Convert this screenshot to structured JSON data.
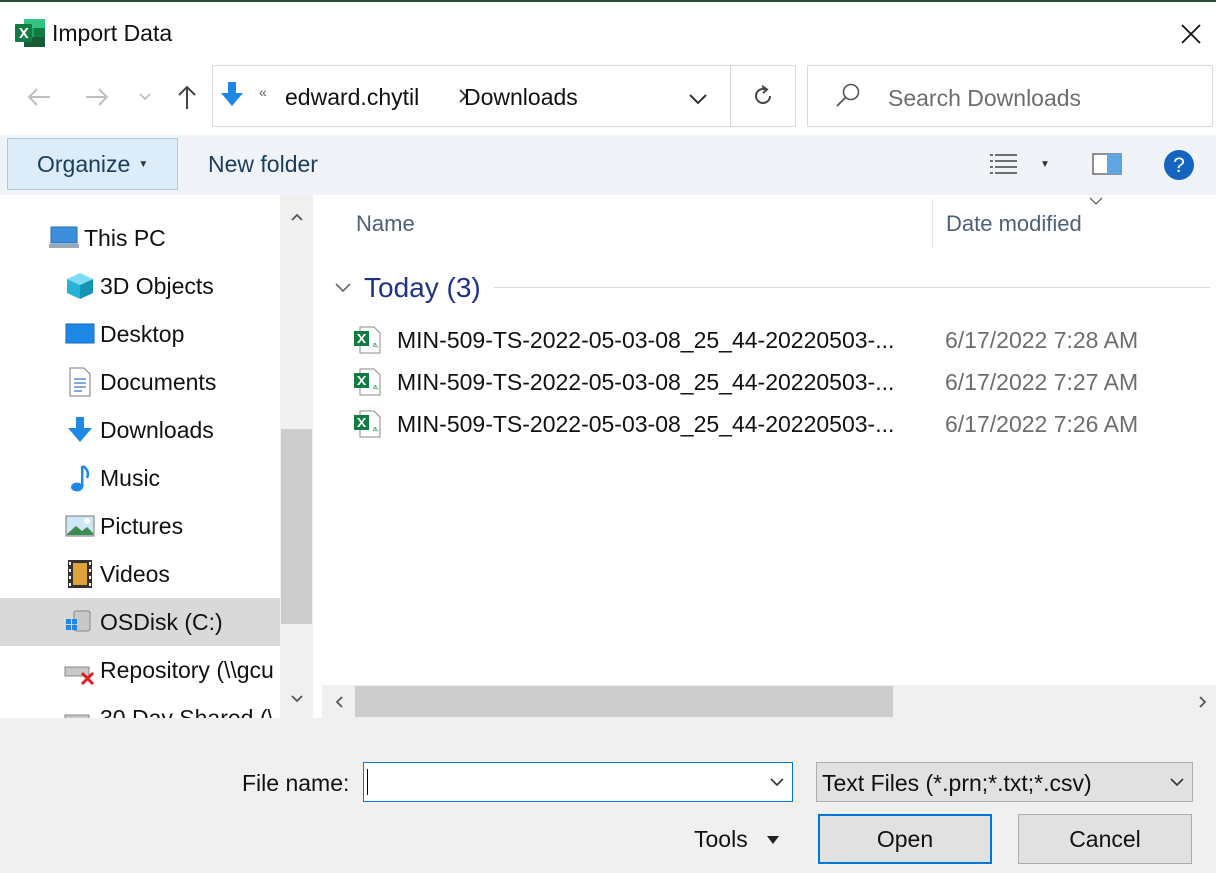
{
  "window": {
    "title": "Import Data",
    "app_icon": "excel-icon",
    "close_icon": "close-icon",
    "frame_color": "#2d4a39"
  },
  "navigation": {
    "back_icon": "back-arrow-icon",
    "forward_icon": "forward-arrow-icon",
    "recent_icon": "chevron-down-icon",
    "up_icon": "up-arrow-icon"
  },
  "address_bar": {
    "folder_icon": "downloads-folder-icon",
    "overflow_chevrons": "«",
    "breadcrumbs": [
      "edward.chytil",
      "Downloads"
    ],
    "dropdown_icon": "chevron-down-icon",
    "refresh_icon": "refresh-icon"
  },
  "search": {
    "placeholder": "Search Downloads",
    "icon": "search-icon"
  },
  "toolbar": {
    "organize_label": "Organize",
    "new_folder_label": "New folder",
    "view_icon": "details-view-icon",
    "preview_pane_icon": "preview-pane-icon",
    "help_icon": "help-icon",
    "accent_color": "#dcecf8"
  },
  "nav_pane": {
    "items": [
      {
        "label": "This PC",
        "icon": "computer-icon"
      },
      {
        "label": "3D Objects",
        "icon": "cube-icon"
      },
      {
        "label": "Desktop",
        "icon": "desktop-icon"
      },
      {
        "label": "Documents",
        "icon": "document-icon"
      },
      {
        "label": "Downloads",
        "icon": "download-icon"
      },
      {
        "label": "Music",
        "icon": "music-note-icon"
      },
      {
        "label": "Pictures",
        "icon": "pictures-icon"
      },
      {
        "label": "Videos",
        "icon": "film-icon"
      },
      {
        "label": "OSDisk (C:)",
        "icon": "drive-icon",
        "selected": true
      },
      {
        "label": "Repository (\\\\gcu",
        "icon": "network-drive-disconnected-icon"
      },
      {
        "label": "30 Day Shared (\\",
        "icon": "network-drive-icon"
      }
    ]
  },
  "file_list": {
    "columns": [
      "Name",
      "Date modified"
    ],
    "group": {
      "label": "Today (3)"
    },
    "files": [
      {
        "name": "MIN-509-TS-2022-05-03-08_25_44-20220503-...",
        "date": "6/17/2022 7:28 AM",
        "icon": "csv-file-icon"
      },
      {
        "name": "MIN-509-TS-2022-05-03-08_25_44-20220503-...",
        "date": "6/17/2022 7:27 AM",
        "icon": "csv-file-icon"
      },
      {
        "name": "MIN-509-TS-2022-05-03-08_25_44-20220503-...",
        "date": "6/17/2022 7:26 AM",
        "icon": "csv-file-icon"
      }
    ]
  },
  "bottom": {
    "file_name_label": "File name:",
    "file_name_value": "",
    "file_type_selected": "Text Files (*.prn;*.txt;*.csv)",
    "tools_label": "Tools",
    "open_label": "Open",
    "cancel_label": "Cancel",
    "focus_color": "#0078d7"
  }
}
